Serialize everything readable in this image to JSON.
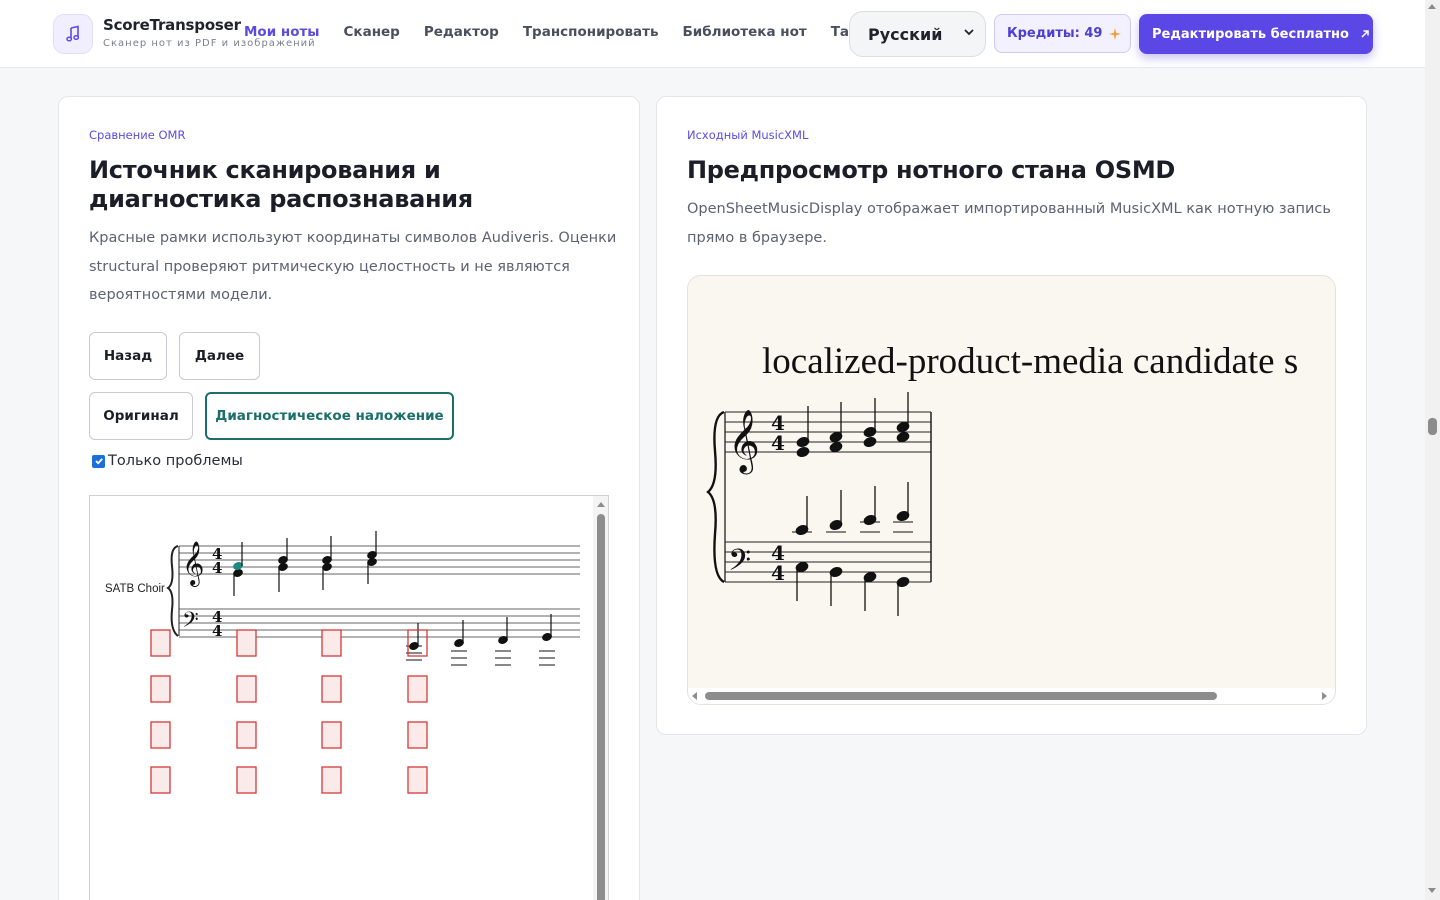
{
  "header": {
    "brand_name": "ScoreTransposer",
    "brand_sub": "Сканер нот из PDF и изображений",
    "nav": [
      {
        "label": "Мои ноты",
        "active": true
      },
      {
        "label": "Сканер"
      },
      {
        "label": "Редактор"
      },
      {
        "label": "Транспонировать"
      },
      {
        "label": "Библиотека нот"
      },
      {
        "label": "Тарифы"
      }
    ],
    "language": "Русский",
    "credits": "Кредиты: 49",
    "cta": "Редактировать бесплатно",
    "accent": "#5a47e6"
  },
  "omr": {
    "eyebrow": "Сравнение OMR",
    "title": "Источник сканирования и диагностика распознавания",
    "description": "Красные рамки используют координаты символов Audiveris. Оценки structural проверяют ритмическую целостность и не являются вероятностями модели.",
    "back": "Назад",
    "next": "Далее",
    "original": "Оригинал",
    "overlay": "Диагностическое наложение",
    "only_problems": "Только проблемы",
    "only_problems_checked": true,
    "part_name": "SATB Choir",
    "box_color": "#d43a3a"
  },
  "osmd": {
    "eyebrow": "Исходный MusicXML",
    "title": "Предпросмотр нотного стана OSMD",
    "description": "OpenSheetMusicDisplay отображает импортированный MusicXML как нотную запись прямо в браузере.",
    "score_title": "localized-product-media candidate s"
  }
}
